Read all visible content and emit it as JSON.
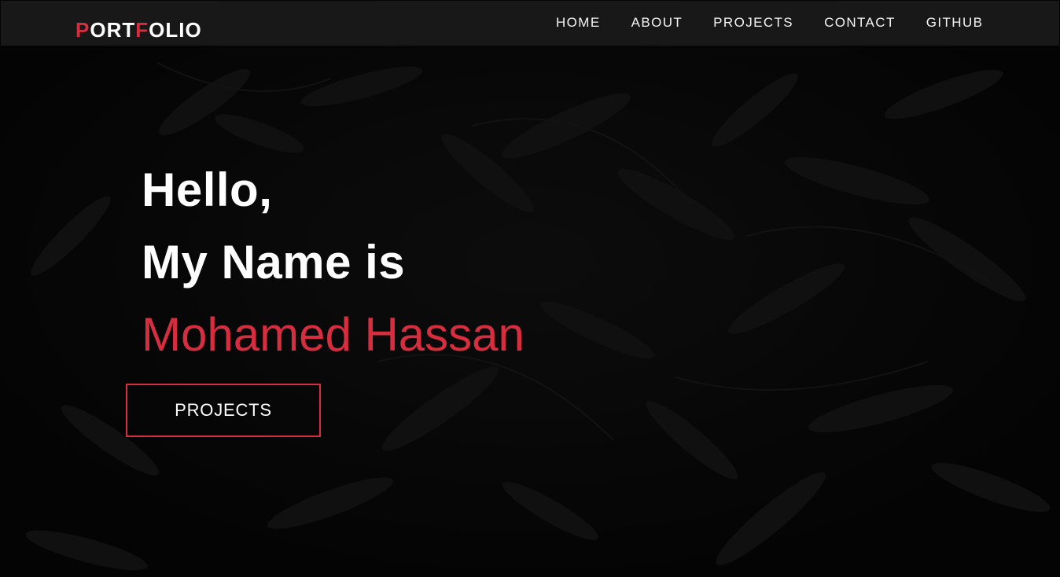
{
  "brand": {
    "segments": [
      {
        "text": "P",
        "accent": true
      },
      {
        "text": "ORT",
        "accent": false
      },
      {
        "text": "F",
        "accent": true
      },
      {
        "text": "OLIO",
        "accent": false
      }
    ]
  },
  "nav": {
    "items": [
      {
        "label": "HOME"
      },
      {
        "label": "ABOUT"
      },
      {
        "label": "PROJECTS"
      },
      {
        "label": "CONTACT"
      },
      {
        "label": "GITHUB"
      }
    ]
  },
  "hero": {
    "line1": "Hello,",
    "line2": "My Name is",
    "name": "Mohamed Hassan",
    "cta_label": "PROJECTS"
  },
  "colors": {
    "accent": "#d62d3f",
    "background": "#030303",
    "navbar": "#1a1a1a",
    "text": "#ffffff"
  }
}
